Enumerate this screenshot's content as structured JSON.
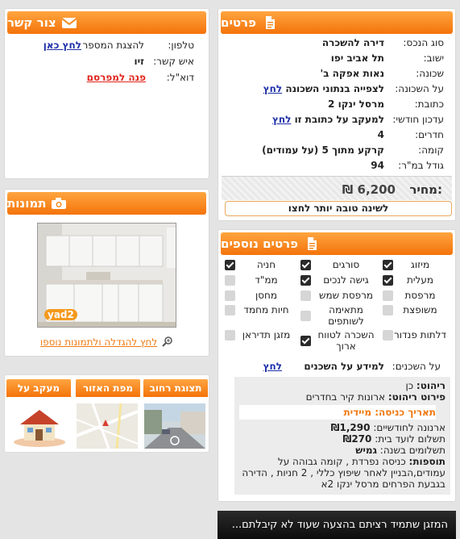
{
  "details": {
    "title": "פרטים",
    "rows": [
      {
        "label": "סוג הנכס:",
        "value": "דירה להשכרה"
      },
      {
        "label": "ישוב:",
        "value": "תל אביב יפו"
      },
      {
        "label": "שכונה:",
        "value": "נאות אפקה ב'"
      },
      {
        "label": "על השכונה:",
        "value": "לצפייה בנתוני השכונה",
        "link": "לחץ"
      },
      {
        "label": "כתובת:",
        "value": "מרסל ינקו 2"
      },
      {
        "label": "עדכון חודשי:",
        "value": "למעקב על כתובת זו",
        "link": "לחץ"
      },
      {
        "label": "חדרים:",
        "value": "4"
      },
      {
        "label": "קומה:",
        "value": "קרקע מתוך 5 (על עמודים)"
      },
      {
        "label": "גודל במ\"ר:",
        "value": "94"
      }
    ],
    "price_label": "מחיר:",
    "price_value": "6,200 ₪",
    "better_offer": "לשינה טובה יותר לחצו"
  },
  "contact": {
    "title": "צור קשר",
    "phone_label": "טלפון:",
    "phone_text": "להצגת המספר",
    "phone_link": "לחץ כאן",
    "person_label": "איש קשר:",
    "person_value": "זיו",
    "email_label": "דוא\"ל:",
    "email_link": "פנה למפרסם"
  },
  "photos": {
    "title": "תמונות",
    "watermark": "yad2",
    "enlarge_link": "לחץ להגדלה ולתמונות נוספו"
  },
  "tabs": [
    {
      "label": "תצוגת רחוב"
    },
    {
      "label": "מפת האזור"
    },
    {
      "label": "מעקב על הנכס"
    }
  ],
  "more": {
    "title": "פרטים נוספים",
    "features": [
      {
        "label": "מיזוג",
        "checked": true
      },
      {
        "label": "סורגים",
        "checked": true
      },
      {
        "label": "חניה",
        "checked": true
      },
      {
        "label": "מעלית",
        "checked": true
      },
      {
        "label": "גישה לנכים",
        "checked": true
      },
      {
        "label": "ממ\"ד",
        "checked": false
      },
      {
        "label": "מרפסת",
        "checked": false
      },
      {
        "label": "מרפסת שמש",
        "checked": false
      },
      {
        "label": "מחסן",
        "checked": false
      },
      {
        "label": "משופצת",
        "checked": false
      },
      {
        "label": "מתאימה לשותפים",
        "checked": false
      },
      {
        "label": "חיות מחמד",
        "checked": false
      },
      {
        "label": "דלתות פנדור",
        "checked": false
      },
      {
        "label": "השכרה לטווח ארוך",
        "checked": true
      },
      {
        "label": "מזגן תדיראן",
        "checked": false
      }
    ],
    "tenants_label": "על השכנים:",
    "tenants_text": "למידע על השכנים",
    "tenants_link": "לחץ",
    "furniture_label": "ריהוט:",
    "furniture_value": "כן",
    "furniture_detail_label": "פירוט ריהוט:",
    "furniture_detail_value": "ארונות קיר בחדרים",
    "entry_label": "תאריך כניסה:",
    "entry_value": "מיידית",
    "arnona_label": "ארנונה לחודשיים:",
    "arnona_value": "₪1,290",
    "vaad_label": "תשלום לועד בית:",
    "vaad_value": "₪270",
    "payments_label": "תשלומים בשנה:",
    "payments_value": "גמיש",
    "extras_label": "תוספות:",
    "extras_value": "כניסה נפרדת , קומה גבוהה על עמודים,הבניין לאחר שיפוץ כללי , 2 חניות , הדירה בגבעת הפרחים מרסל ינקו 2א"
  },
  "banner": {
    "text": "המזגן שתמיד רציתם בהצעה שעוד לא קיבלתם..."
  }
}
